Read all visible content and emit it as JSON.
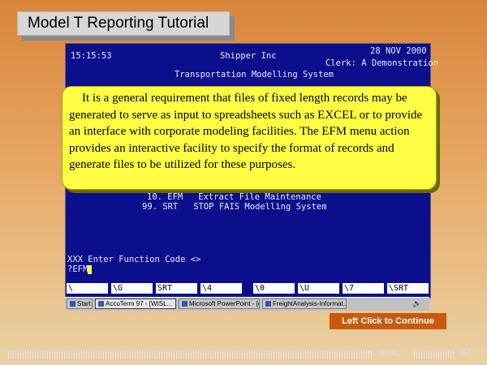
{
  "slide": {
    "title": "Model T Reporting Tutorial",
    "continue_label": "Left Click to Continue",
    "footer_org": "WISL",
    "page_number": "67"
  },
  "terminal": {
    "time": "15:15:53",
    "company": "Shipper Inc",
    "date": "28 NOV 2000",
    "clerk": "Clerk: A Demonstration",
    "system_title": "Transportation Modelling System",
    "menu_items": [
      "10. EFM   Extract File Maintenance",
      "99. SRT   STOP FAIS Modelling System"
    ],
    "prompt": "XXX Enter Function Code <>",
    "input_value": "?EFM",
    "function_keys": [
      "\\",
      "\\G",
      "SRT",
      "\\4",
      "\\0",
      "\\U",
      "\\7",
      "\\SRT"
    ]
  },
  "taskbar": {
    "start": "Start",
    "items": [
      "AccuTerm 97 - [WISL...",
      "Microsoft PowerPoint - [ed...",
      "FreightAnalysis-Informat..."
    ]
  },
  "callout": {
    "text": "It is a general requirement that files of fixed length records may be generated to serve as input to spreadsheets such as EXCEL or to provide an interface with corporate modeling facilities. The EFM menu action provides an interactive facility to specify the format of records and generate files to be utilized for these purposes."
  }
}
